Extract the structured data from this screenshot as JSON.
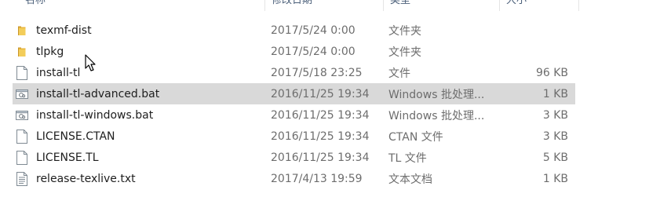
{
  "columns": {
    "name": "名称",
    "date_modified": "修改日期",
    "type": "类型",
    "size": "大小"
  },
  "files": [
    {
      "name": "texmf-dist",
      "date": "2017/5/24 0:00",
      "type": "文件夹",
      "size": "",
      "icon": "folder-icon",
      "selected": false
    },
    {
      "name": "tlpkg",
      "date": "2017/5/24 0:00",
      "type": "文件夹",
      "size": "",
      "icon": "folder-icon",
      "selected": false
    },
    {
      "name": "install-tl",
      "date": "2017/5/18 23:25",
      "type": "文件",
      "size": "96 KB",
      "icon": "file-icon",
      "selected": false
    },
    {
      "name": "install-tl-advanced.bat",
      "date": "2016/11/25 19:34",
      "type": "Windows 批处理...",
      "size": "1 KB",
      "icon": "batch-file-icon",
      "selected": true
    },
    {
      "name": "install-tl-windows.bat",
      "date": "2016/11/25 19:34",
      "type": "Windows 批处理...",
      "size": "3 KB",
      "icon": "batch-file-icon",
      "selected": false
    },
    {
      "name": "LICENSE.CTAN",
      "date": "2016/11/25 19:34",
      "type": "CTAN 文件",
      "size": "3 KB",
      "icon": "file-icon",
      "selected": false
    },
    {
      "name": "LICENSE.TL",
      "date": "2016/11/25 19:34",
      "type": "TL 文件",
      "size": "5 KB",
      "icon": "file-icon",
      "selected": false
    },
    {
      "name": "release-texlive.txt",
      "date": "2017/4/13 19:59",
      "type": "文本文档",
      "size": "1 KB",
      "icon": "text-file-icon",
      "selected": false
    }
  ],
  "colors": {
    "selected_row": "#d9d9d9",
    "folder": "#e8b53a",
    "header_text": "#4c607a",
    "secondary_text": "#6d6d6d"
  },
  "cursor_icon": "mouse-pointer-icon"
}
